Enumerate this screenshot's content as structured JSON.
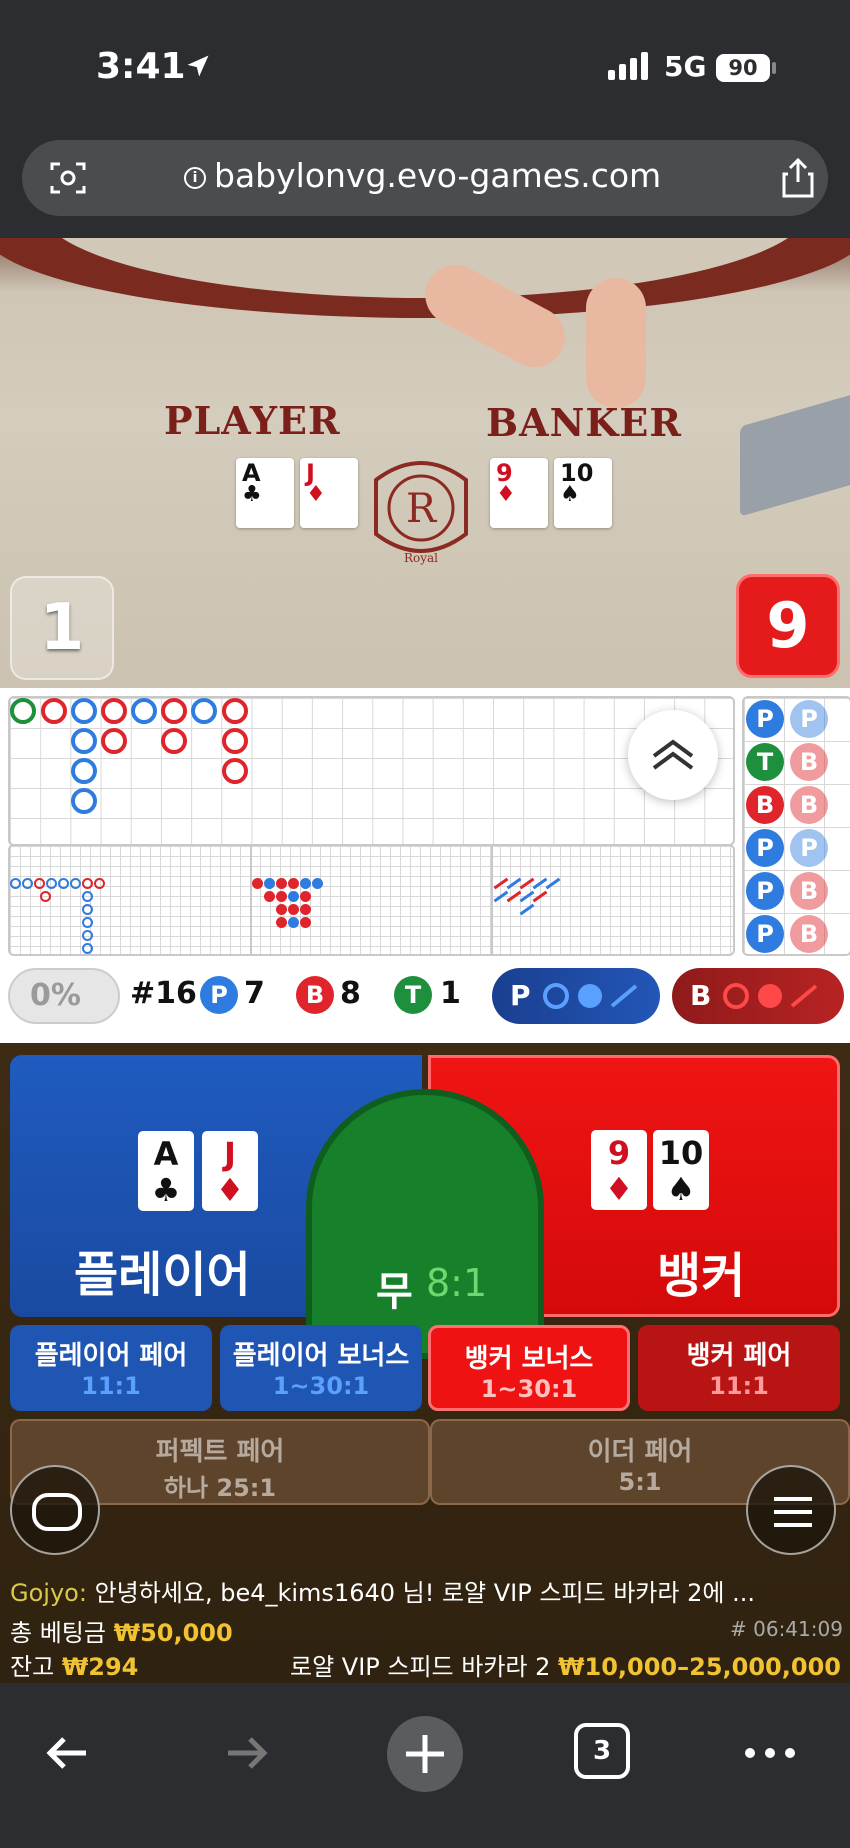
{
  "status": {
    "time": "3:41",
    "network": "5G",
    "battery": "90"
  },
  "browser": {
    "url": "babylonvg.evo-games.com",
    "tab_count": "3"
  },
  "table": {
    "player_label": "PLAYER",
    "banker_label": "BANKER",
    "emblem_letter": "R",
    "emblem_word": "Royal",
    "player_cards": [
      {
        "rank": "A",
        "suit": "♣",
        "color": "black"
      },
      {
        "rank": "J",
        "suit": "♦",
        "color": "red"
      }
    ],
    "banker_cards": [
      {
        "rank": "9",
        "suit": "♦",
        "color": "red"
      },
      {
        "rank": "10",
        "suit": "♠",
        "color": "black"
      }
    ],
    "player_score": "1",
    "banker_score": "9"
  },
  "stats": {
    "percent": "0%",
    "round": "#16",
    "p_label": "P",
    "p_count": "7",
    "b_label": "B",
    "b_count": "8",
    "t_label": "T",
    "t_count": "1",
    "p_pred_label": "P",
    "b_pred_label": "B"
  },
  "bead_road": [
    [
      "P",
      "P"
    ],
    [
      "T",
      "B"
    ],
    [
      "B",
      "B"
    ],
    [
      "P",
      "P"
    ],
    [
      "P",
      "B"
    ],
    [
      "P",
      "B"
    ]
  ],
  "bets": {
    "player": "플레이어",
    "tie": "무",
    "tie_odds": "8:1",
    "banker": "뱅커",
    "player_pair": "플레이어 페어",
    "player_pair_odds": "11:1",
    "player_bonus": "플레이어 보너스",
    "player_bonus_odds": "1~30:1",
    "banker_bonus": "뱅커 보너스",
    "banker_bonus_odds": "1~30:1",
    "banker_pair": "뱅커 페어",
    "banker_pair_odds": "11:1",
    "perfect_pair": "퍼펙트 페어",
    "perfect_pair_odds": "하나 25:1",
    "either_pair": "이더 페어",
    "either_pair_odds": "5:1"
  },
  "chat": {
    "user": "Gojyo:",
    "message": "안녕하세요, be4_kims1640 님! 로얄 VIP 스피드 바카라 2에 ..."
  },
  "footer": {
    "total_bet_label": "총 베팅금",
    "total_bet": "₩50,000",
    "round_id": "# 06:41:09",
    "balance_label": "잔고",
    "balance": "₩294",
    "table_name": "로얄 VIP 스피드 바카라 2",
    "limits": "₩10,000–25,000,000"
  },
  "colors": {
    "player": "#1f5bc0",
    "banker": "#e0242b",
    "tie": "#16802b",
    "gold": "#f1c232"
  }
}
